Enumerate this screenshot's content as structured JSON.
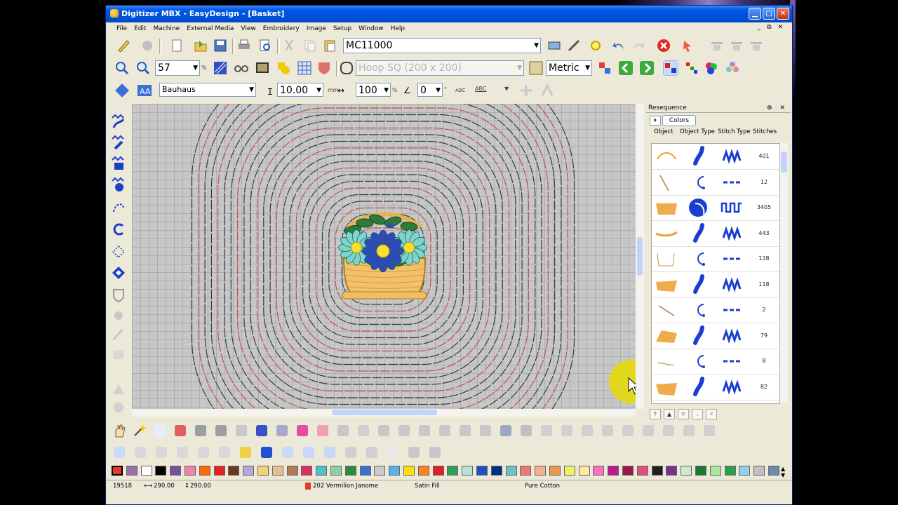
{
  "window": {
    "title": "Digitizer MBX - EasyDesign - [Basket]"
  },
  "menu": [
    "File",
    "Edit",
    "Machine",
    "External Media",
    "View",
    "Embroidery",
    "Image",
    "Setup",
    "Window",
    "Help"
  ],
  "toolbar": {
    "machine_value": "MC11000",
    "zoom_value": "57",
    "zoom_unit": "%",
    "hoop_value": "Hoop SQ (200 x 200)",
    "units_value": "Metric"
  },
  "text_toolbar": {
    "font_value": "Bauhaus",
    "size_value": "10.00",
    "size_unit": "mm",
    "width_value": "100",
    "width_unit": "%",
    "angle_value": "0",
    "angle_unit": "°",
    "abc_label1": "ABC",
    "abc_label2": "ABC"
  },
  "resequence": {
    "title": "Resequence",
    "colors_button": "Colors",
    "columns": [
      "Object",
      "Object Type",
      "Stitch Type",
      "Stitches"
    ],
    "rows": [
      {
        "stitches": "401",
        "object_type": "satin-line",
        "stitch_type": "zigzag"
      },
      {
        "stitches": "12",
        "object_type": "running-line",
        "stitch_type": "running"
      },
      {
        "stitches": "3405",
        "object_type": "fill-area",
        "stitch_type": "fill"
      },
      {
        "stitches": "443",
        "object_type": "satin-line",
        "stitch_type": "zigzag"
      },
      {
        "stitches": "128",
        "object_type": "running-line",
        "stitch_type": "running"
      },
      {
        "stitches": "118",
        "object_type": "satin-line",
        "stitch_type": "zigzag"
      },
      {
        "stitches": "2",
        "object_type": "running-line",
        "stitch_type": "running"
      },
      {
        "stitches": "79",
        "object_type": "satin-line",
        "stitch_type": "zigzag"
      },
      {
        "stitches": "8",
        "object_type": "running-line",
        "stitch_type": "running"
      },
      {
        "stitches": "82",
        "object_type": "satin-line",
        "stitch_type": "zigzag"
      }
    ]
  },
  "palette_colors": [
    "#e53b2c",
    "#9c6fa8",
    "#ffffff",
    "#000000",
    "#7a4f9e",
    "#f080b0",
    "#ff6a00",
    "#e2241c",
    "#6b3a1e",
    "#b8a6d8",
    "#f5d07a",
    "#e6c08a",
    "#b07a55",
    "#d83060",
    "#4ec0c8",
    "#8ed0a8",
    "#2c8a3a",
    "#3c6fd0",
    "#c9c9c9",
    "#5cb0e8",
    "#ffe000",
    "#ff8020",
    "#e02020",
    "#2fa058",
    "#b8e0d8",
    "#1e4fc0",
    "#003080",
    "#6cc4c0",
    "#f07878",
    "#f4b090",
    "#e89850",
    "#f0f060",
    "#ffe8a0",
    "#ff70c0",
    "#c01890",
    "#9c1848",
    "#e05078",
    "#202020",
    "#7a3090",
    "#d0e8d0",
    "#1a7a30",
    "#a8e8a0",
    "#2aa048",
    "#90d0e8",
    "#c0c0c0",
    "#6a8ab0"
  ],
  "status": {
    "stitch_count": "19518",
    "width": "290.00",
    "height": "290.00",
    "thread": "202 Vermilion Janome",
    "stitch_type": "Satin Fill",
    "fabric": "Pure Cotton"
  },
  "colors": {
    "accent": "#0058e6",
    "panel_bg": "#ece9d8"
  }
}
